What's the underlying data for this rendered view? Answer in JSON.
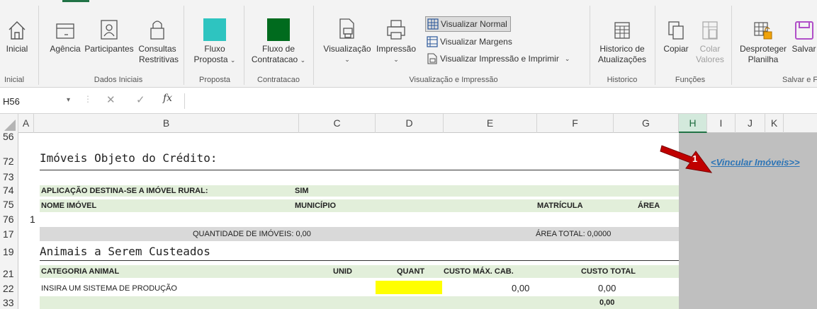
{
  "ribbon": {
    "buttons": {
      "inicial": "Inicial",
      "agencia": "Agência",
      "participantes": "Participantes",
      "consultas1": "Consultas",
      "consultas2": "Restritivas",
      "fluxo_proposta1": "Fluxo",
      "fluxo_proposta2": "Proposta",
      "fluxo_contratacao1": "Fluxo de",
      "fluxo_contratacao2": "Contratacao",
      "visualizacao": "Visualização",
      "impressao": "Impressão",
      "visualizar_normal": "Visualizar Normal",
      "visualizar_margens": "Visualizar Margens",
      "visualizar_impressao_imprimir": "Visualizar Impressão e Imprimir",
      "historico1": "Historico de",
      "historico2": "Atualizações",
      "copiar": "Copiar",
      "colar1": "Colar",
      "colar2": "Valores",
      "desproteger1": "Desproteger",
      "desproteger2": "Planilha",
      "salvar": "Salvar"
    },
    "groups": {
      "inicial": "Inicial",
      "dados_iniciais": "Dados Iniciais",
      "proposta": "Proposta",
      "contratacao": "Contratacao",
      "visualizacao_impressao": "Visualização e Impressão",
      "historico": "Historico",
      "funcoes": "Funções",
      "salvar": "Salvar e F"
    },
    "colors": {
      "fluxo_proposta": "#2ec4c0",
      "fluxo_contratacao": "#006b1e",
      "salvar": "#b04fc8"
    }
  },
  "formula_bar": {
    "name_box": "H56",
    "fx": "fx",
    "content": ""
  },
  "columns": [
    "A",
    "B",
    "C",
    "D",
    "E",
    "F",
    "G",
    "H",
    "I",
    "J",
    "K"
  ],
  "rows": [
    "56",
    "72",
    "73",
    "74",
    "75",
    "76",
    "17",
    "19",
    "21",
    "22",
    "33"
  ],
  "sheet": {
    "row76_number": "1",
    "imoveis_title": "Imóveis Objeto do Crédito:",
    "aplicacao_label": "APLICAÇÃO DESTINA-SE A IMÓVEL RURAL:",
    "aplicacao_value": "SIM",
    "nome_imovel": "NOME IMÓVEL",
    "municipio": "MUNICÍPIO",
    "matricula": "MATRÍCULA",
    "area": "ÁREA",
    "quantidade_imoveis": "QUANTIDADE DE IMÓVEIS: 0,00",
    "area_total": "ÁREA TOTAL: 0,0000",
    "animais_title": "Animais a Serem Custeados",
    "categoria_animal": "CATEGORIA ANIMAL",
    "unid": "UNID",
    "quant": "QUANT",
    "custo_max_cab": "CUSTO MÁX. CAB.",
    "custo_total": "CUSTO TOTAL",
    "sistema_producao": "INSIRA UM SISTEMA DE PRODUÇÃO",
    "custo_max_value": "0,00",
    "custo_total_value": "0,00",
    "total_sum": "0,00",
    "vincular_link": "<Vincular Imóveis>>"
  },
  "annotation": {
    "number": "1",
    "color": "#c00000"
  }
}
